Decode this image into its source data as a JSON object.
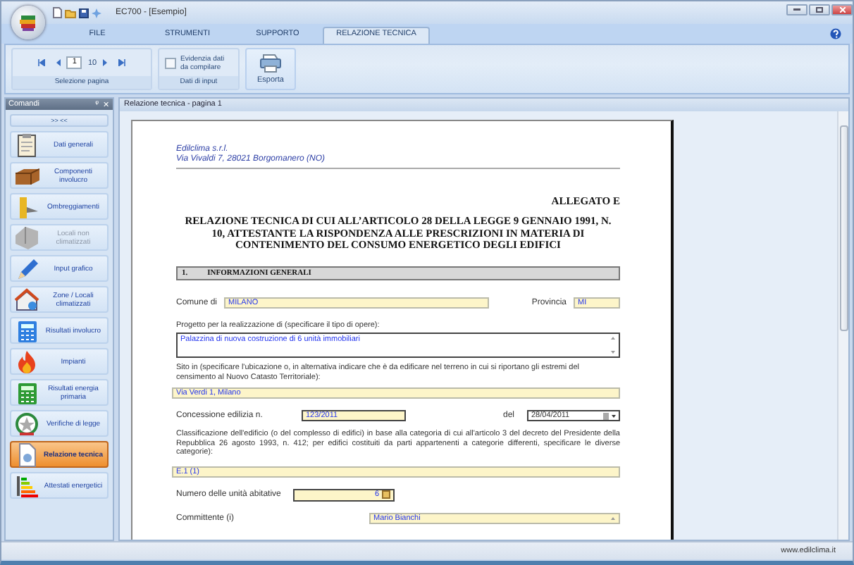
{
  "window": {
    "title": "EC700 - [Esempio]"
  },
  "ribbon_tabs": [
    {
      "label": "FILE",
      "selected": false
    },
    {
      "label": "STRUMENTI",
      "selected": false
    },
    {
      "label": "SUPPORTO",
      "selected": false
    },
    {
      "label": "RELAZIONE TECNICA",
      "selected": true
    }
  ],
  "ribbon": {
    "page_selection": {
      "current_page": "1",
      "total_pages": "10",
      "group_label": "Selezione pagina"
    },
    "input_data": {
      "checkbox": {
        "label": "Evidenzia dati da compilare",
        "checked": false
      },
      "group_label": "Dati di input"
    },
    "export_button": {
      "label": "Esporta"
    }
  },
  "sidebar": {
    "title": "Comandi",
    "pin": "ᵠ",
    "close": "✕",
    "collapse": ">> <<",
    "items": [
      {
        "label": "Dati generali",
        "selected": false,
        "disabled": false
      },
      {
        "label": "Componenti involucro",
        "selected": false,
        "disabled": false
      },
      {
        "label": "Ombreggiamenti",
        "selected": false,
        "disabled": false
      },
      {
        "label": "Locali non climatizzati",
        "selected": false,
        "disabled": true
      },
      {
        "label": "Input grafico",
        "selected": false,
        "disabled": false
      },
      {
        "label": "Zone / Locali climatizzati",
        "selected": false,
        "disabled": false
      },
      {
        "label": "Risultati involucro",
        "selected": false,
        "disabled": false
      },
      {
        "label": "Impianti",
        "selected": false,
        "disabled": false
      },
      {
        "label": "Risultati energia primaria",
        "selected": false,
        "disabled": false
      },
      {
        "label": "Verifiche di legge",
        "selected": false,
        "disabled": false
      },
      {
        "label": "Relazione tecnica",
        "selected": true,
        "disabled": false
      },
      {
        "label": "Attestati energetici",
        "selected": false,
        "disabled": false
      }
    ]
  },
  "document": {
    "header": "Relazione tecnica - pagina 1",
    "company": "Edilclima s.r.l.",
    "address": "Via Vivaldi 7, 28021 Borgomanero (NO)",
    "annex": "ALLEGATO E",
    "title": "RELAZIONE TECNICA DI CUI ALL’ARTICOLO 28 DELLA LEGGE 9 GENNAIO 1991, N. 10, ATTESTANTE LA RISPONDENZA ALLE PRESCRIZIONI IN MATERIA DI CONTENIMENTO DEL CONSUMO ENERGETICO DEGLI EDIFICI",
    "section": {
      "number": "1.",
      "title": "INFORMAZIONI GENERALI"
    },
    "comune": {
      "label": "Comune di",
      "value": "MILANO"
    },
    "provincia": {
      "label": "Provincia",
      "value": "MI"
    },
    "progetto": {
      "label": "Progetto per la realizzazione di (specificare il tipo di opere):",
      "value": "Palazzina di nuova costruzione di 6 unità immobiliari"
    },
    "sito": {
      "label": "Sito in (specificare l'ubicazione o, in alternativa indicare che è da edificare nel terreno in cui si riportano gli estremi del censimento al Nuovo Catasto Territoriale):",
      "value": "Via Verdi 1, Milano"
    },
    "concessione": {
      "label": "Concessione edilizia n.",
      "value": "123/2011"
    },
    "data": {
      "label": "del",
      "value": "28/04/2011"
    },
    "classificazione": {
      "label": "Classificazione dell'edificio (o del complesso di edifici) in base alla categoria di cui all'articolo 3 del decreto del Presidente della Repubblica 26 agosto 1993, n. 412; per edifici costituiti da parti appartenenti a categorie differenti, specificare le diverse categorie):",
      "value": "E.1 (1)"
    },
    "unita": {
      "label": "Numero delle unità abitative",
      "value": "6"
    },
    "committente": {
      "label": "Committente (i)",
      "value": "Mario Bianchi"
    }
  },
  "status_bar": {
    "website": "www.edilclima.it"
  }
}
